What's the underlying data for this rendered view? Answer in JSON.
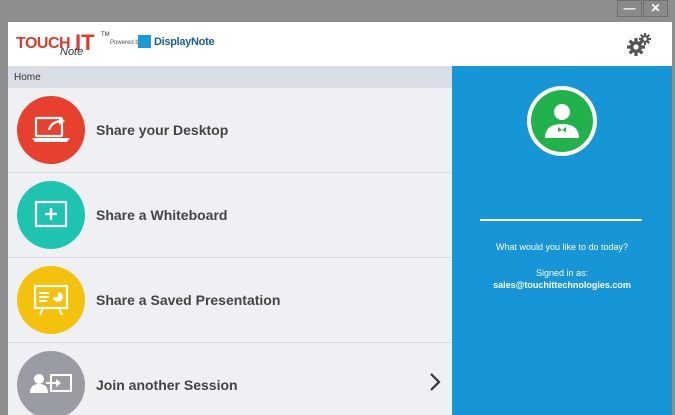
{
  "window": {
    "minimize_label": "—",
    "close_label": "✕"
  },
  "header": {
    "logo_touch": "TOUCH",
    "logo_it": "IT",
    "logo_note": "Note",
    "logo_tm": "TM",
    "logo_powered": "Powered by",
    "logo_brand": "DisplayNote",
    "settings_icon": "gear-icon"
  },
  "breadcrumb": {
    "label": "Home"
  },
  "menu": {
    "items": [
      {
        "label": "Share your Desktop",
        "icon": "desktop-share-icon",
        "color": "#e8402f"
      },
      {
        "label": "Share a Whiteboard",
        "icon": "whiteboard-add-icon",
        "color": "#1ec4b0"
      },
      {
        "label": "Share a Saved Presentation",
        "icon": "presentation-icon",
        "color": "#f4c20d"
      },
      {
        "label": "Join another Session",
        "icon": "join-session-icon",
        "color": "#9a9ca3"
      }
    ],
    "chevron_icon": "chevron-right-icon"
  },
  "profile": {
    "avatar_icon": "user-avatar-icon",
    "question": "What would you like to do today?",
    "signed_in_label": "Signed in as:",
    "email": "sales@touchittechnologies.com"
  },
  "colors": {
    "panel_blue": "#1696d6",
    "avatar_green": "#22b24c",
    "menu_bg": "#eff0f3",
    "breadcrumb_bg": "#d9dde6"
  }
}
